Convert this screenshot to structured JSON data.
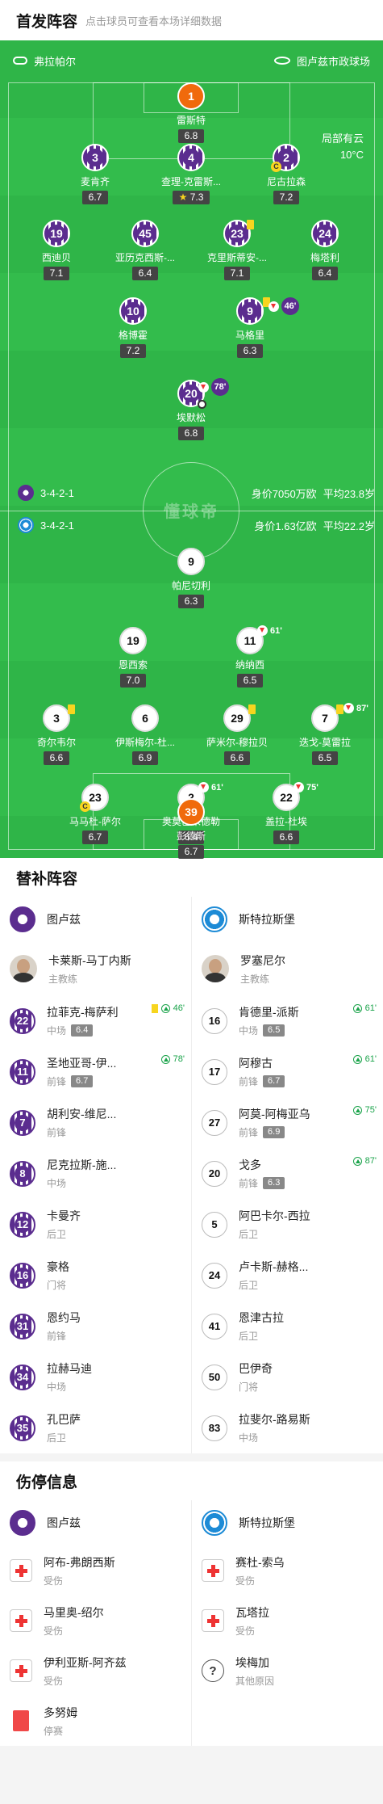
{
  "header": {
    "title": "首发阵容",
    "hint": "点击球员可查看本场详细数据"
  },
  "pitch": {
    "referee": "弗拉帕尔",
    "stadium": "图卢兹市政球场",
    "weather": "局部有云",
    "temperature": "10°C",
    "watermark": "懂球帝",
    "home_formation": {
      "formation": "3-4-2-1",
      "value": "身价7050万欧",
      "age": "平均23.8岁"
    },
    "away_formation": {
      "formation": "3-4-2-1",
      "value": "身价1.63亿欧",
      "age": "平均22.2岁"
    }
  },
  "home_players": [
    {
      "num": "1",
      "name": "雷斯特",
      "rating": "6.8"
    },
    {
      "num": "3",
      "name": "麦肯齐",
      "rating": "6.7"
    },
    {
      "num": "4",
      "name": "查理-克雷斯...",
      "rating": "7.3"
    },
    {
      "num": "2",
      "name": "尼古拉森",
      "rating": "7.2"
    },
    {
      "num": "19",
      "name": "西迪贝",
      "rating": "7.1"
    },
    {
      "num": "45",
      "name": "亚历克西斯-...",
      "rating": "6.4"
    },
    {
      "num": "23",
      "name": "克里斯蒂安-...",
      "rating": "7.1"
    },
    {
      "num": "24",
      "name": "梅塔利",
      "rating": "6.4"
    },
    {
      "num": "10",
      "name": "格博霍",
      "rating": "7.2"
    },
    {
      "num": "9",
      "name": "马格里",
      "rating": "6.3",
      "event": "46'"
    },
    {
      "num": "20",
      "name": "埃默松",
      "rating": "6.8",
      "event": "78'"
    }
  ],
  "away_players": [
    {
      "num": "9",
      "name": "帕尼切利",
      "rating": "6.3"
    },
    {
      "num": "19",
      "name": "恩西索",
      "rating": "7.0"
    },
    {
      "num": "11",
      "name": "纳纳西",
      "rating": "6.5",
      "event": "61'"
    },
    {
      "num": "3",
      "name": "奇尔韦尔",
      "rating": "6.6"
    },
    {
      "num": "6",
      "name": "伊斯梅尔-杜...",
      "rating": "6.9"
    },
    {
      "num": "29",
      "name": "萨米尔-穆拉贝",
      "rating": "6.6"
    },
    {
      "num": "7",
      "name": "迭戈-莫雷拉",
      "rating": "6.5",
      "event": "87'"
    },
    {
      "num": "23",
      "name": "马马杜-萨尔",
      "rating": "6.7"
    },
    {
      "num": "2",
      "name": "奥莫巴米德勒",
      "rating": "6.4",
      "event": "61'"
    },
    {
      "num": "22",
      "name": "盖拉-杜埃",
      "rating": "6.6",
      "event": "75'"
    },
    {
      "num": "39",
      "name": "彭德斯",
      "rating": "6.7"
    }
  ],
  "subs": {
    "title": "替补阵容",
    "home_team": "图卢兹",
    "away_team": "斯特拉斯堡",
    "home_coach": {
      "name": "卡莱斯-马丁内斯",
      "role": "主教练"
    },
    "away_coach": {
      "name": "罗塞尼尔",
      "role": "主教练"
    },
    "home": [
      {
        "num": "22",
        "name": "拉菲克-梅萨利",
        "pos": "中场",
        "rating": "6.4",
        "event": "46'"
      },
      {
        "num": "11",
        "name": "圣地亚哥-伊...",
        "pos": "前锋",
        "rating": "6.7",
        "event": "78'"
      },
      {
        "num": "7",
        "name": "胡利安-维尼...",
        "pos": "前锋"
      },
      {
        "num": "8",
        "name": "尼克拉斯-施...",
        "pos": "中场"
      },
      {
        "num": "12",
        "name": "卡曼齐",
        "pos": "后卫"
      },
      {
        "num": "16",
        "name": "豪格",
        "pos": "门将"
      },
      {
        "num": "31",
        "name": "恩约马",
        "pos": "前锋"
      },
      {
        "num": "34",
        "name": "拉赫马迪",
        "pos": "中场"
      },
      {
        "num": "35",
        "name": "孔巴萨",
        "pos": "后卫"
      }
    ],
    "away": [
      {
        "num": "16",
        "name": "肯德里-派斯",
        "pos": "中场",
        "rating": "6.5",
        "event": "61'"
      },
      {
        "num": "17",
        "name": "阿穆古",
        "pos": "前锋",
        "rating": "6.7",
        "event": "61'"
      },
      {
        "num": "27",
        "name": "阿莫-阿梅亚乌",
        "pos": "前锋",
        "rating": "6.9",
        "event": "75'"
      },
      {
        "num": "20",
        "name": "戈多",
        "pos": "前锋",
        "rating": "6.3",
        "event": "87'"
      },
      {
        "num": "5",
        "name": "阿巴卡尔-西拉",
        "pos": "后卫"
      },
      {
        "num": "24",
        "name": "卢卡斯-赫格...",
        "pos": "后卫"
      },
      {
        "num": "41",
        "name": "恩津古拉",
        "pos": "后卫"
      },
      {
        "num": "50",
        "name": "巴伊奇",
        "pos": "门将"
      },
      {
        "num": "83",
        "name": "拉斐尔-路易斯",
        "pos": "中场"
      }
    ]
  },
  "injuries": {
    "title": "伤停信息",
    "home_team": "图卢兹",
    "away_team": "斯特拉斯堡",
    "home": [
      {
        "name": "阿布-弗朗西斯",
        "reason": "受伤",
        "icon": "injury-icon"
      },
      {
        "name": "马里奥-绍尔",
        "reason": "受伤",
        "icon": "injury-icon"
      },
      {
        "name": "伊利亚斯-阿齐兹",
        "reason": "受伤",
        "icon": "injury-icon"
      },
      {
        "name": "多努姆",
        "reason": "停赛",
        "icon": "red-card-icon"
      }
    ],
    "away": [
      {
        "name": "赛杜-索乌",
        "reason": "受伤",
        "icon": "injury-icon"
      },
      {
        "name": "瓦塔拉",
        "reason": "受伤",
        "icon": "injury-icon"
      },
      {
        "name": "埃梅加",
        "reason": "其他原因",
        "icon": "question-icon"
      }
    ]
  },
  "colors": {
    "pitch": "#2fb548",
    "home": "#5b2d8f",
    "away_gk": "#f06a0c",
    "event_green": "#1aa34a"
  }
}
